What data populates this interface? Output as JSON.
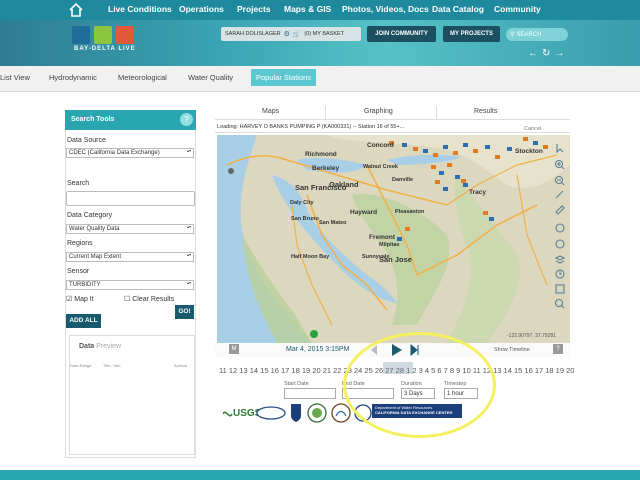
{
  "nav": {
    "items": [
      "Live Conditions",
      "Operations",
      "Projects",
      "Maps & GIS",
      "Photos, Videos, Docs",
      "Data Catalog",
      "Community"
    ]
  },
  "header": {
    "logo_text": "BAY-DELTA LIVE",
    "user": "SARAH DOLISLAGER",
    "basket": "(0) MY BASKET",
    "join": "JOIN COMMUNITY",
    "my_projects": "MY PROJECTS",
    "search_placeholder": "SEARCH"
  },
  "tabs": [
    "List View",
    "Hydrodynamic",
    "Meteorological",
    "Water Quality",
    "Popular Stations"
  ],
  "active_tab": "Popular Stations",
  "search_tools": {
    "title": "Search Tools",
    "help": "?",
    "data_source_label": "Data Source",
    "data_source_value": "CDEC (California Data Exchange)",
    "search_label": "Search",
    "search_value": "",
    "category_label": "Data Category",
    "category_value": "Water Quality Data",
    "regions_label": "Regions",
    "regions_value": "Current Map Extent",
    "sensor_label": "Sensor",
    "sensor_value": "TURBIDITY",
    "map_it": "Map It",
    "clear_results": "Clear Results",
    "add_all": "ADD ALL",
    "go": "GO!"
  },
  "data_preview": {
    "title_a": "Data ",
    "title_b": "Preview",
    "cols": [
      "Data Range",
      "Title / Info",
      "Actions"
    ]
  },
  "map_tabs": [
    "Maps",
    "Graphing",
    "Results"
  ],
  "loading_text": "Loading: HARVEY O BANKS PUMPING P (KA000331) -- Station 16 of 55+...",
  "cancel": "Cancel",
  "map": {
    "cities": [
      {
        "name": "Concord"
      },
      {
        "name": "Richmond"
      },
      {
        "name": "Berkeley"
      },
      {
        "name": "Walnut Creek"
      },
      {
        "name": "Danville"
      },
      {
        "name": "San Francisco"
      },
      {
        "name": "Oakland"
      },
      {
        "name": "Hayward"
      },
      {
        "name": "Fremont"
      },
      {
        "name": "San Jose"
      },
      {
        "name": "Daly City"
      },
      {
        "name": "San Bruno"
      },
      {
        "name": "Half Moon Bay"
      },
      {
        "name": "Stockton"
      },
      {
        "name": "Tracy"
      },
      {
        "name": "Milpitas"
      },
      {
        "name": "San Mateo"
      },
      {
        "name": "Sunnyvale"
      },
      {
        "name": "Pleasanton"
      }
    ],
    "coords": "-122.90797, 37.79281"
  },
  "timeline": {
    "m": "M",
    "date": "Mar 4, 2015 3:15PM",
    "show_timeline": "Show Timeline",
    "q": "?",
    "numbers": "11 12 13 14 15 16 17 18 19 20 21 22 23 24 25 26 27 28 1 2 3 4 5 6 7 8 9 10 11 12 13 14 15 16 17 18 19 20"
  },
  "filters": {
    "start_label": "Start Date",
    "end_label": "End Date",
    "duration_label": "Duration",
    "duration_value": "3 Days",
    "timestep_label": "Timestep",
    "timestep_value": "1 hour"
  },
  "logos": {
    "usgs": "USGS",
    "cdec_line1": "Department of Water Resources",
    "cdec_line2": "CALIFORNIA DATA EXCHANGE CENTER"
  },
  "colors": {
    "teal": "#2aa6b3",
    "dark": "#1a5a6e",
    "highlight": "#f5f060"
  }
}
